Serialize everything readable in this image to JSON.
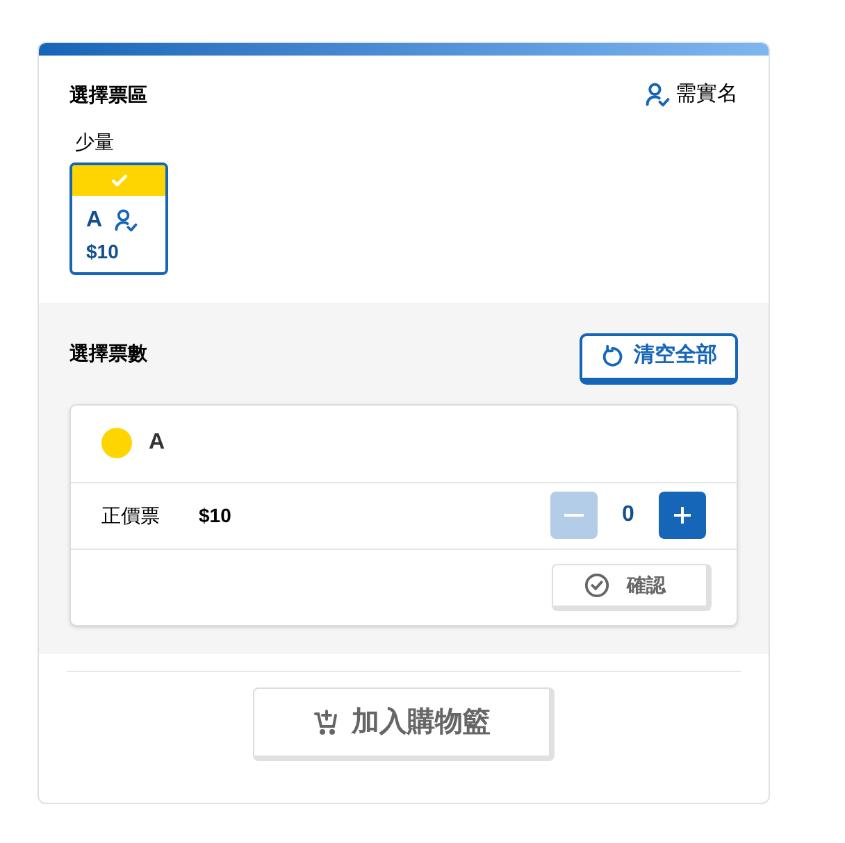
{
  "zone_section": {
    "title": "選擇票區",
    "real_name_label": "需實名",
    "groups": [
      {
        "name": "少量",
        "zones": [
          {
            "label": "A",
            "price": "$10",
            "selected": true,
            "real_name": true
          }
        ]
      }
    ]
  },
  "quantity_section": {
    "title": "選擇票數",
    "clear_button": "清空全部",
    "zones": [
      {
        "name": "A",
        "color": "#ffd500",
        "tickets": [
          {
            "type": "正價票",
            "price": "$10",
            "count": "0",
            "minus_disabled": true,
            "plus_disabled": false
          }
        ],
        "confirm": {
          "label": "確認",
          "disabled": true
        }
      }
    ]
  },
  "add_to_cart": {
    "label": "加入購物籃",
    "disabled": true
  }
}
